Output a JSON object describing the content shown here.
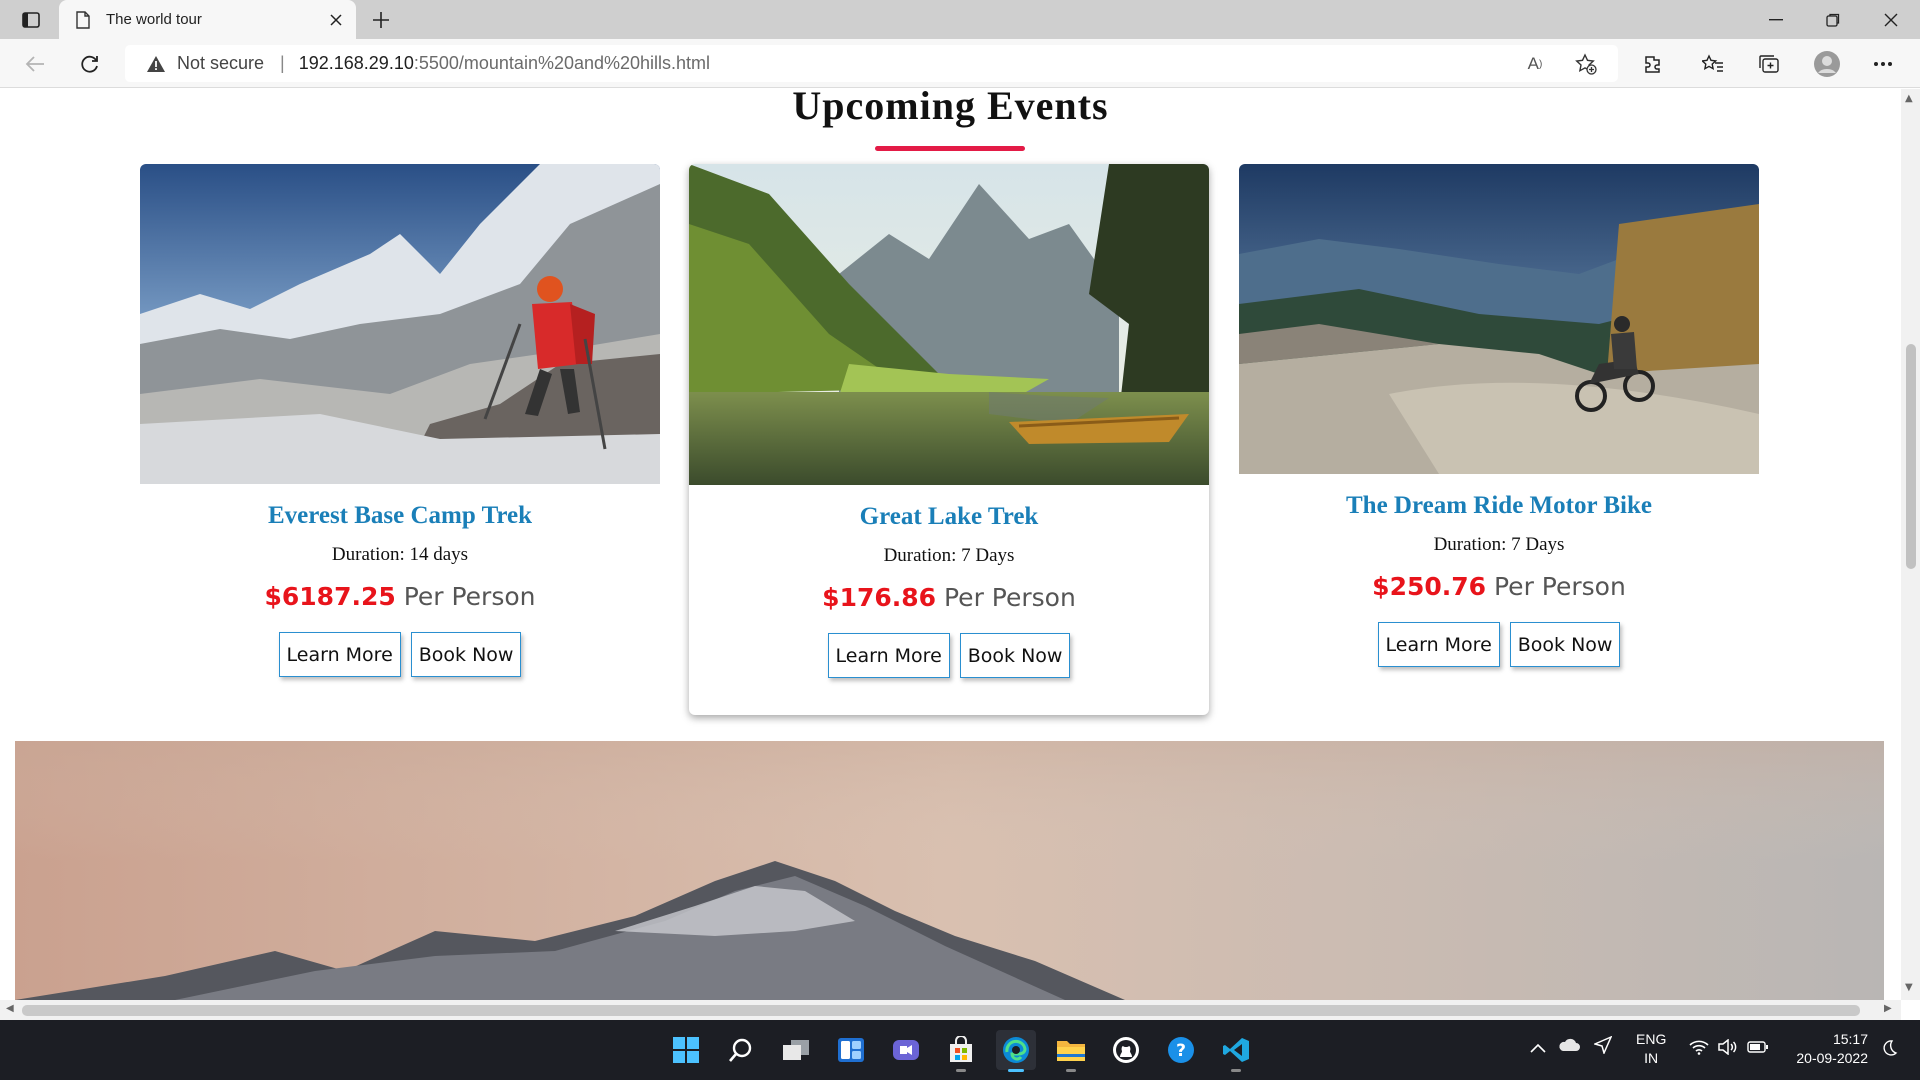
{
  "browser": {
    "tab_title": "The world tour",
    "address": {
      "security_label": "Not secure",
      "host": "192.168.29.10",
      "path": ":5500/mountain%20and%20hills.html"
    }
  },
  "page": {
    "section_title": "Upcoming Events",
    "accent_color": "#e31b46",
    "events": [
      {
        "name": "Everest Base Camp Trek",
        "duration": "Duration: 14 days",
        "price": "$6187.25",
        "per": "Per Person",
        "learn_more": "Learn More",
        "book_now": "Book Now"
      },
      {
        "name": "Great Lake Trek",
        "duration": "Duration: 7 Days",
        "price": "$176.86",
        "per": "Per Person",
        "learn_more": "Learn More",
        "book_now": "Book Now"
      },
      {
        "name": "The Dream Ride Motor Bike",
        "duration": "Duration: 7 Days",
        "price": "$250.76",
        "per": "Per Person",
        "learn_more": "Learn More",
        "book_now": "Book Now"
      }
    ]
  },
  "taskbar": {
    "icons": [
      "windows-start-icon",
      "search-icon",
      "task-view-icon",
      "widgets-icon",
      "chat-icon",
      "microsoft-store-icon",
      "edge-icon",
      "file-explorer-icon",
      "github-icon",
      "help-icon",
      "vscode-icon"
    ],
    "tray": {
      "language": "ENG",
      "region": "IN",
      "time": "15:17",
      "date": "20-09-2022"
    }
  }
}
